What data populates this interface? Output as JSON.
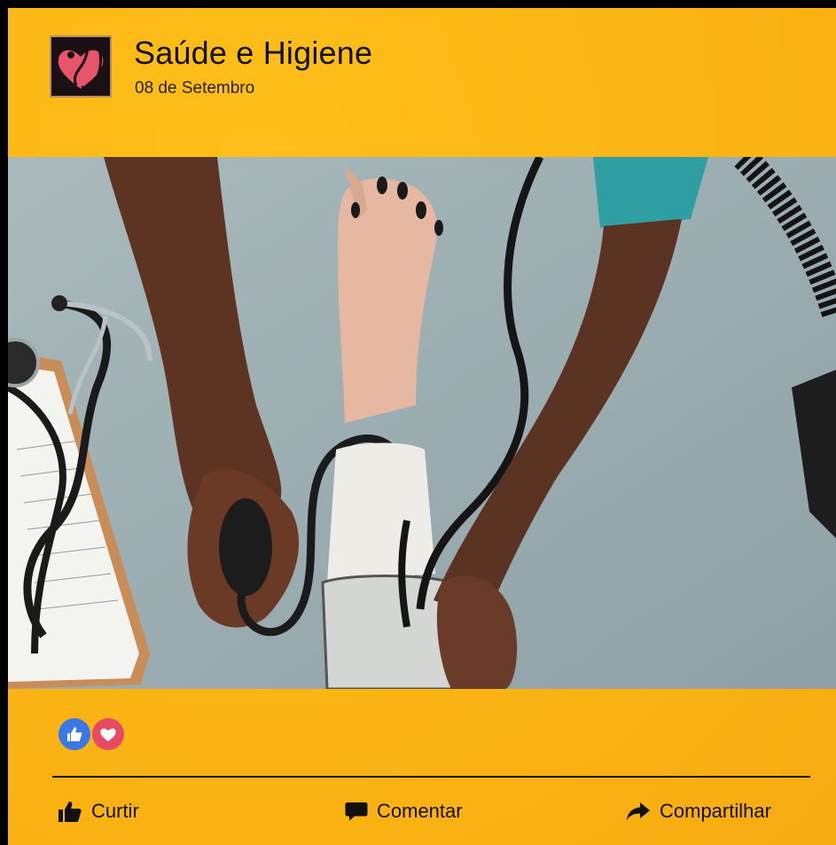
{
  "post": {
    "page_name": "Saúde e Higiene",
    "date": "08 de Setembro",
    "avatar_icon": "heart-stethoscope-logo",
    "photo_icon": "blood-pressure-measurement-photo"
  },
  "reactions": {
    "icons": [
      "like-reaction-icon",
      "love-reaction-icon"
    ]
  },
  "actions": {
    "like_label": "Curtir",
    "comment_label": "Comentar",
    "share_label": "Compartilhar"
  },
  "colors": {
    "background": "#fbb414",
    "like_blue": "#3b78e7",
    "love_red": "#e74a63",
    "text": "#111111"
  }
}
